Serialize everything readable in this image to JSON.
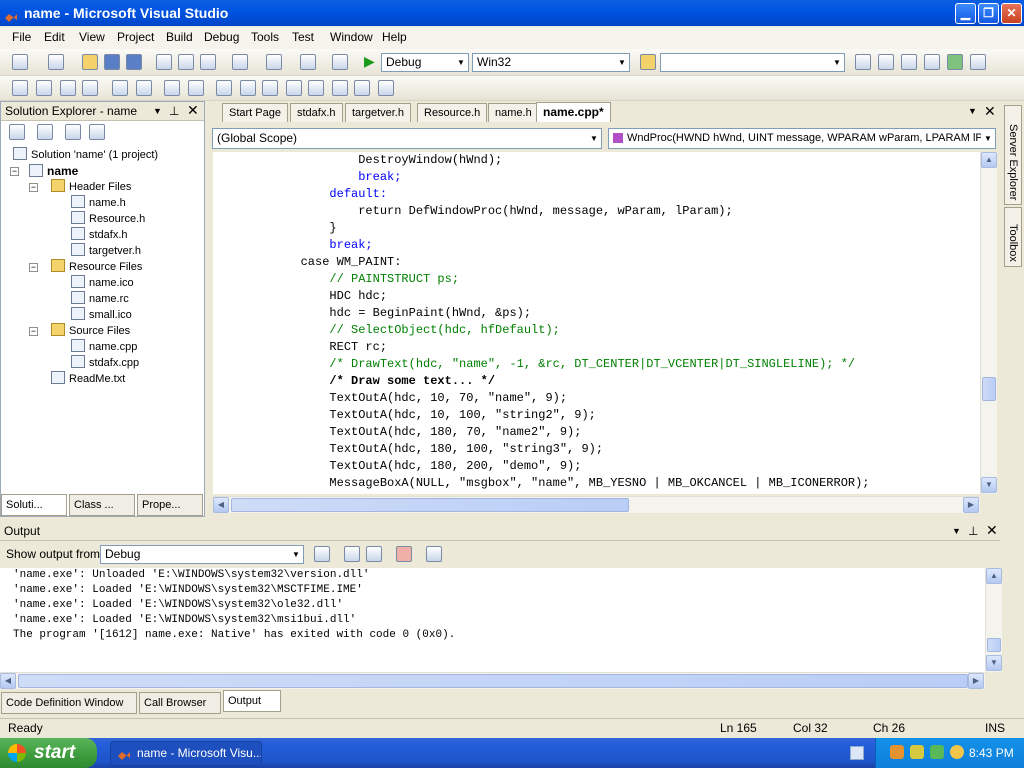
{
  "window": {
    "title": "name - Microsoft Visual Studio"
  },
  "menu": [
    "File",
    "Edit",
    "View",
    "Project",
    "Build",
    "Debug",
    "Tools",
    "Test",
    "Window",
    "Help"
  ],
  "toolbar": {
    "config": "Debug",
    "platform": "Win32",
    "find": ""
  },
  "solution_explorer": {
    "title": "Solution Explorer - name",
    "items": [
      {
        "label": "Solution 'name' (1 project)"
      },
      {
        "label": "name"
      },
      {
        "label": "Header Files"
      },
      {
        "label": "name.h"
      },
      {
        "label": "Resource.h"
      },
      {
        "label": "stdafx.h"
      },
      {
        "label": "targetver.h"
      },
      {
        "label": "Resource Files"
      },
      {
        "label": "name.ico"
      },
      {
        "label": "name.rc"
      },
      {
        "label": "small.ico"
      },
      {
        "label": "Source Files"
      },
      {
        "label": "name.cpp"
      },
      {
        "label": "stdafx.cpp"
      },
      {
        "label": "ReadMe.txt"
      }
    ],
    "tabs": [
      "Soluti...",
      "Class ...",
      "Prope..."
    ]
  },
  "editor": {
    "tabs": [
      "Start Page",
      "stdafx.h",
      "targetver.h",
      "Resource.h",
      "name.h",
      "name.cpp*"
    ],
    "scope": "(Global Scope)",
    "function": "WndProc(HWND hWnd, UINT message, WPARAM wParam, LPARAM lPara",
    "lines": [
      "                DestroyWindow(hWnd);",
      "                break;",
      "            default:",
      "                return DefWindowProc(hWnd, message, wParam, lParam);",
      "            }",
      "            break;",
      "        case WM_PAINT:",
      "            // PAINTSTRUCT ps;",
      "            HDC hdc;",
      "            hdc = BeginPaint(hWnd, &ps);",
      "            // SelectObject(hdc, hfDefault);",
      "            RECT rc;",
      "            /* DrawText(hdc, \"name\", -1, &rc, DT_CENTER|DT_VCENTER|DT_SINGLELINE); */",
      "            /* Draw some text... */",
      "            TextOutA(hdc, 10, 70, \"name\", 9);",
      "            TextOutA(hdc, 10, 100, \"string2\", 9);",
      "            TextOutA(hdc, 180, 70, \"name2\", 9);",
      "            TextOutA(hdc, 180, 100, \"string3\", 9);",
      "            TextOutA(hdc, 180, 200, \"demo\", 9);",
      "            MessageBoxA(NULL, \"msgbox\", \"name\", MB_YESNO | MB_OKCANCEL | MB_ICONERROR);"
    ]
  },
  "side_tabs": [
    "Server Explorer",
    "Toolbox"
  ],
  "output": {
    "title": "Output",
    "show_from_label": "Show output from:",
    "show_from_value": "Debug",
    "lines": [
      "'name.exe': Unloaded 'E:\\WINDOWS\\system32\\version.dll'",
      "'name.exe': Loaded 'E:\\WINDOWS\\system32\\MSCTFIME.IME'",
      "'name.exe': Loaded 'E:\\WINDOWS\\system32\\ole32.dll'",
      "'name.exe': Loaded 'E:\\WINDOWS\\system32\\msi1bui.dll'",
      "The program '[1612] name.exe: Native' has exited with code 0 (0x0)."
    ],
    "bottom_tabs": [
      "Code Definition Window",
      "Call Browser",
      "Output"
    ]
  },
  "status": {
    "ready": "Ready",
    "ln": "Ln 165",
    "col": "Col 32",
    "ch": "Ch 26",
    "ins": "INS"
  },
  "taskbar": {
    "start": "start",
    "item": "name - Microsoft Visu...",
    "time": "8:43 PM"
  }
}
